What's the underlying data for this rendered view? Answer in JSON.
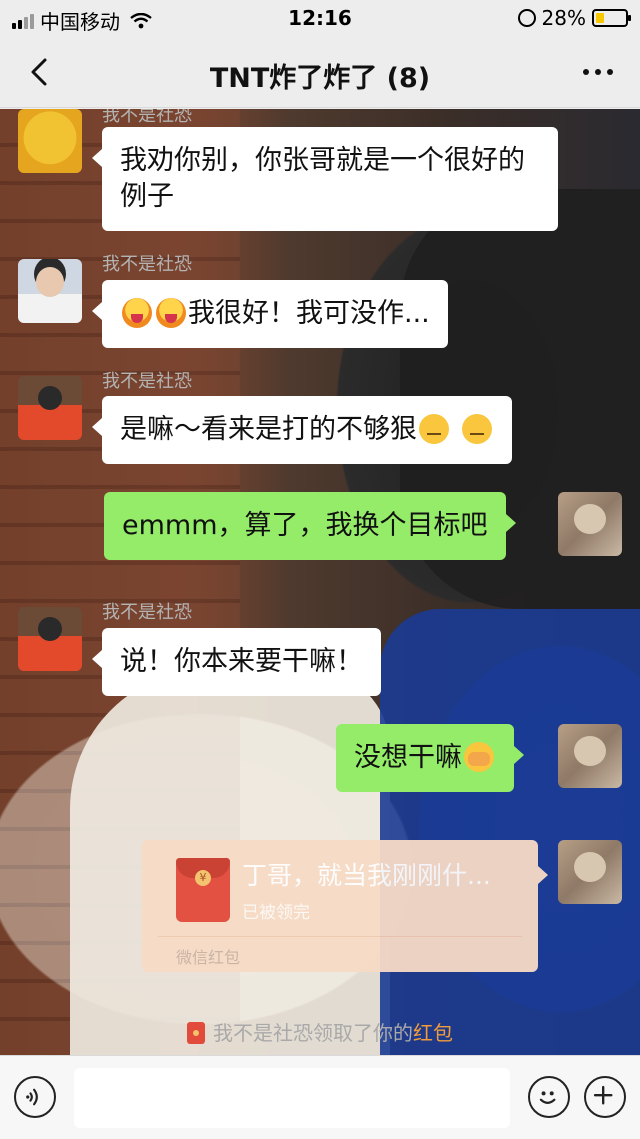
{
  "status_bar": {
    "carrier": "中国移动",
    "time": "12:16",
    "battery": "28%",
    "battery_level": 0.28
  },
  "nav": {
    "title": "TNT炸了炸了 (8)"
  },
  "messages": [
    {
      "type": "in",
      "sender": "我不是社恐",
      "avatar": "yellow-bird-avatar",
      "text": "我劝你别，你张哥就是一个很好的例子",
      "emoji": []
    },
    {
      "type": "in",
      "sender": "我不是社恐",
      "avatar": "boy-avatar",
      "text": "我很好！我可没作...",
      "emoji": [
        "hot-face",
        "hot-face"
      ]
    },
    {
      "type": "in",
      "sender": "我不是社恐",
      "avatar": "red-shirt-avatar",
      "text": "是嘛～看来是打的不够狠",
      "emoji": [
        "unamused-face",
        "unamused-face"
      ]
    },
    {
      "type": "out",
      "avatar": "bear-avatar",
      "text": "emmm，算了，我换个目标吧",
      "emoji": []
    },
    {
      "type": "in",
      "sender": "我不是社恐",
      "avatar": "red-shirt-avatar",
      "text": "说！你本来要干嘛！",
      "emoji": []
    },
    {
      "type": "out",
      "avatar": "bear-avatar",
      "text": "没想干嘛",
      "emoji": [
        "face-with-hands"
      ]
    },
    {
      "type": "red_packet",
      "avatar": "bear-avatar",
      "title": "丁哥，就当我刚刚什...",
      "status": "已被领完",
      "footer": "微信红包"
    }
  ],
  "system_note": {
    "text": "我不是社恐领取了你的",
    "link": "红包"
  },
  "input_bar": {
    "placeholder": ""
  },
  "colors": {
    "outgoing_bubble": "#95ec69",
    "incoming_bubble": "#ffffff",
    "red_packet": "#f7dbc6",
    "link": "#f19c3b"
  }
}
